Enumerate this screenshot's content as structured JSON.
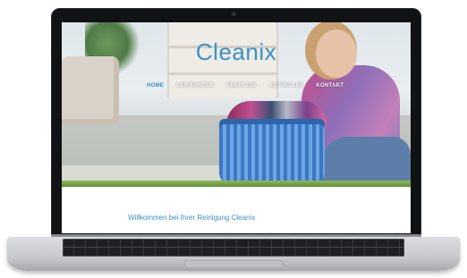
{
  "site": {
    "logo": "Cleanix",
    "nav": [
      {
        "label": "HOME",
        "active": true
      },
      {
        "label": "LEISTUNGEN",
        "active": false
      },
      {
        "label": "ÜBER UNS",
        "active": false
      },
      {
        "label": "AKTUELLES",
        "active": false
      },
      {
        "label": "KONTAKT",
        "active": false
      }
    ],
    "welcome_heading": "Willkommen bei Ihrer Reinigung Cleanix"
  },
  "colors": {
    "brand": "#3a92c6",
    "nav_active": "#2a88c8",
    "nav_text": "#ffffff",
    "laptop_bezel": "#111214",
    "laptop_body": "#c8c9cd"
  }
}
